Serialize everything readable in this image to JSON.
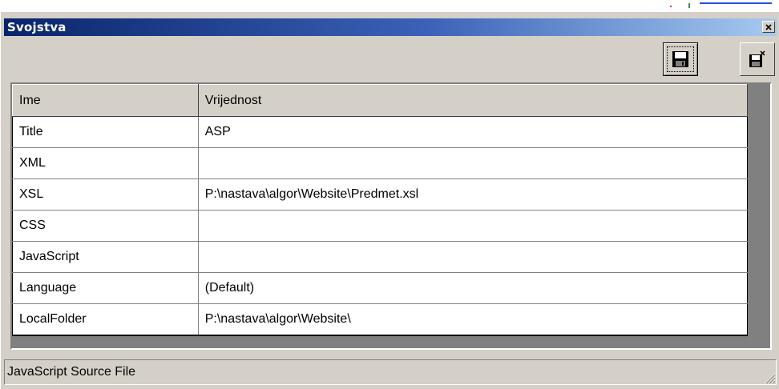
{
  "window": {
    "title": "Svojstva",
    "titlebar_colors": [
      "#0a246a",
      "#a6caf0"
    ],
    "face_color": "#d4d0c8"
  },
  "toolbar": {
    "buttons": [
      {
        "name": "save",
        "icon": "floppy-disk-icon"
      },
      {
        "name": "close-file",
        "icon": "floppy-close-icon"
      }
    ]
  },
  "grid": {
    "columns": [
      "Ime",
      "Vrijednost"
    ],
    "rows": [
      {
        "name": "Title",
        "value": "ASP"
      },
      {
        "name": "XML",
        "value": ""
      },
      {
        "name": "XSL",
        "value": "P:\\nastava\\algor\\Website\\Predmet.xsl"
      },
      {
        "name": "CSS",
        "value": ""
      },
      {
        "name": "JavaScript",
        "value": ""
      },
      {
        "name": "Language",
        "value": "(Default)"
      },
      {
        "name": "LocalFolder",
        "value": "P:\\nastava\\algor\\Website\\"
      }
    ]
  },
  "status": {
    "text": "JavaScript Source File"
  }
}
